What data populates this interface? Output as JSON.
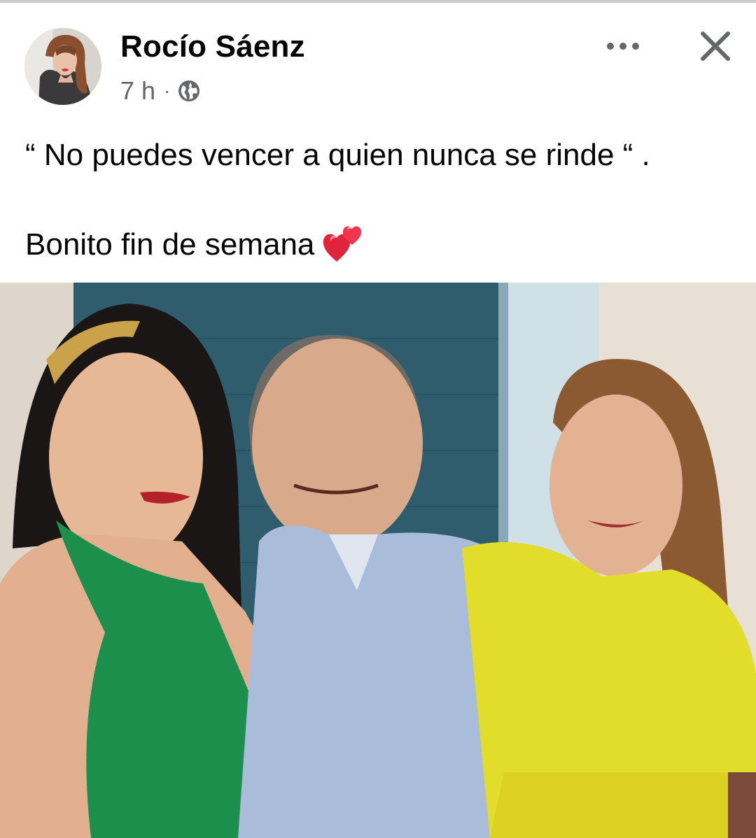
{
  "post": {
    "author": "Rocío Sáenz",
    "time": "7 h",
    "separator": "·",
    "audience_icon": "globe-icon",
    "more_icon": "more-horizontal-icon",
    "close_icon": "close-icon",
    "text_line_1": "“ No puedes vencer a quien nunca se rinde “ .",
    "text_line_2": "Bonito fin de semana",
    "text_emoji": "two-hearts-emoji"
  },
  "colors": {
    "text_primary": "#050505",
    "text_secondary": "#65676b",
    "divider": "#c9ccd1"
  }
}
